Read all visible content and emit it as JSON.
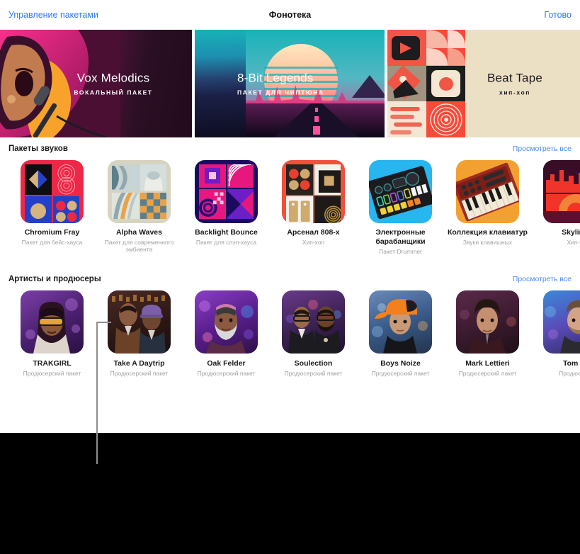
{
  "navbar": {
    "left_label": "Управление пакетами",
    "title": "Фонотека",
    "right_label": "Готово"
  },
  "heroes": [
    {
      "title": "Vox Melodics",
      "subtitle": "ВОКАЛЬНЫЙ ПАКЕТ",
      "art": "singer-microphone"
    },
    {
      "title": "8-Bit Legends",
      "subtitle": "ПАКЕТ ДЛЯ ЧИПТЮНА",
      "art": "synthwave-sunset-road"
    },
    {
      "title": "Beat Tape",
      "subtitle": "хип-хоп",
      "art": "abstract-collage-grid"
    }
  ],
  "sections": [
    {
      "title": "Пакеты звуков",
      "see_all": "Просмотреть все",
      "cards": [
        {
          "title": "Chromium Fray",
          "subtitle": "Пакет для бейс-хауса",
          "art": "geometric-red"
        },
        {
          "title": "Alpha Waves",
          "subtitle": "Пакет для современного эмбиента",
          "art": "geometric-sage"
        },
        {
          "title": "Backlight Bounce",
          "subtitle": "Пакет для слэп-хауса",
          "art": "geometric-navy"
        },
        {
          "title": "Арсенал 808-х",
          "subtitle": "Хип-хоп",
          "art": "geometric-coral"
        },
        {
          "title": "Электронные барабанщики",
          "subtitle": "Пакет Drummer",
          "art": "drum-machine-blue"
        },
        {
          "title": "Коллекция клавиатур",
          "subtitle": "Звуки клавишных",
          "art": "synth-keyboard-orange"
        },
        {
          "title": "Skyline",
          "subtitle": "Хип-х",
          "art": "city-skyline-maroon"
        }
      ]
    },
    {
      "title": "Артисты и продюсеры",
      "see_all": "Просмотреть все",
      "cards": [
        {
          "title": "TRAKGIRL",
          "subtitle": "Продюсерский пакет",
          "art": "portrait-woman-glasses"
        },
        {
          "title": "Take A Daytrip",
          "subtitle": "Продюсерский пакет",
          "art": "portrait-duo"
        },
        {
          "title": "Oak Felder",
          "subtitle": "Продюсерский пакет",
          "art": "portrait-man-beard"
        },
        {
          "title": "Soulection",
          "subtitle": "Продюсерский пакет",
          "art": "portrait-pair-glasses"
        },
        {
          "title": "Boys Noize",
          "subtitle": "Продюсерский пакет",
          "art": "portrait-man-cap"
        },
        {
          "title": "Mark Lettieri",
          "subtitle": "Продюсерский пакет",
          "art": "portrait-man-curly"
        },
        {
          "title": "Tom M",
          "subtitle": "Продюсерс",
          "art": "portrait-man-blonde"
        }
      ]
    }
  ],
  "colors": {
    "link": "#3478f6",
    "see_all": "#4a8cf7",
    "sheet_bg": "#ffffff",
    "page_bg": "#000000",
    "callout_line": "#8e8e8e"
  }
}
